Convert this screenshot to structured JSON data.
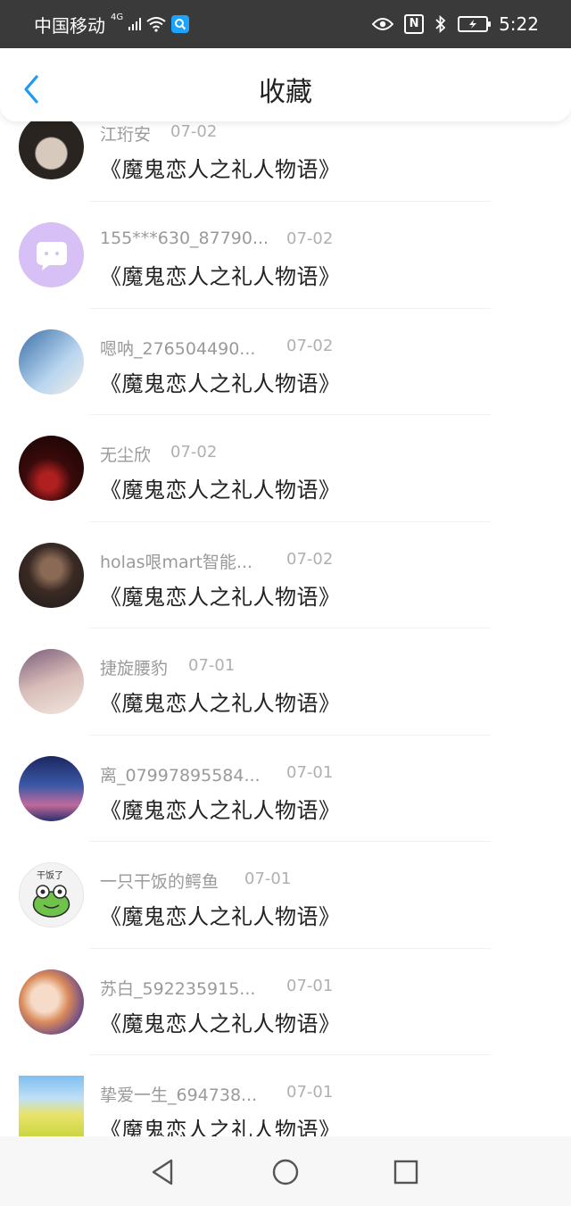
{
  "status_bar": {
    "carrier": "中国移动",
    "network": "4G",
    "time": "5:22",
    "nfc_label": "N"
  },
  "header": {
    "title": "收藏"
  },
  "items": [
    {
      "name": "江珩安",
      "date": "07-02",
      "title": "《魔鬼恋人之礼人物语》"
    },
    {
      "name": "155***630_87790...",
      "date": "07-02",
      "title": "《魔鬼恋人之礼人物语》"
    },
    {
      "name": "嗯呐_276504490...",
      "date": "07-02",
      "title": "《魔鬼恋人之礼人物语》"
    },
    {
      "name": "无尘欣",
      "date": "07-02",
      "title": "《魔鬼恋人之礼人物语》"
    },
    {
      "name": "holas哏mart智能...",
      "date": "07-02",
      "title": "《魔鬼恋人之礼人物语》"
    },
    {
      "name": "捷旋腰豹",
      "date": "07-01",
      "title": "《魔鬼恋人之礼人物语》"
    },
    {
      "name": "离_07997895584...",
      "date": "07-01",
      "title": "《魔鬼恋人之礼人物语》"
    },
    {
      "name": "一只干饭的鳄鱼",
      "date": "07-01",
      "title": "《魔鬼恋人之礼人物语》"
    },
    {
      "name": "苏白_592235915...",
      "date": "07-01",
      "title": "《魔鬼恋人之礼人物语》"
    },
    {
      "name": "挚爱一生_694738...",
      "date": "07-01",
      "title": "《魔鬼恋人之礼人物语》"
    }
  ],
  "avatar_badge_text": "干饭了",
  "colors": {
    "accent": "#1e9bf0",
    "status_bar": "#3a3a3a"
  }
}
